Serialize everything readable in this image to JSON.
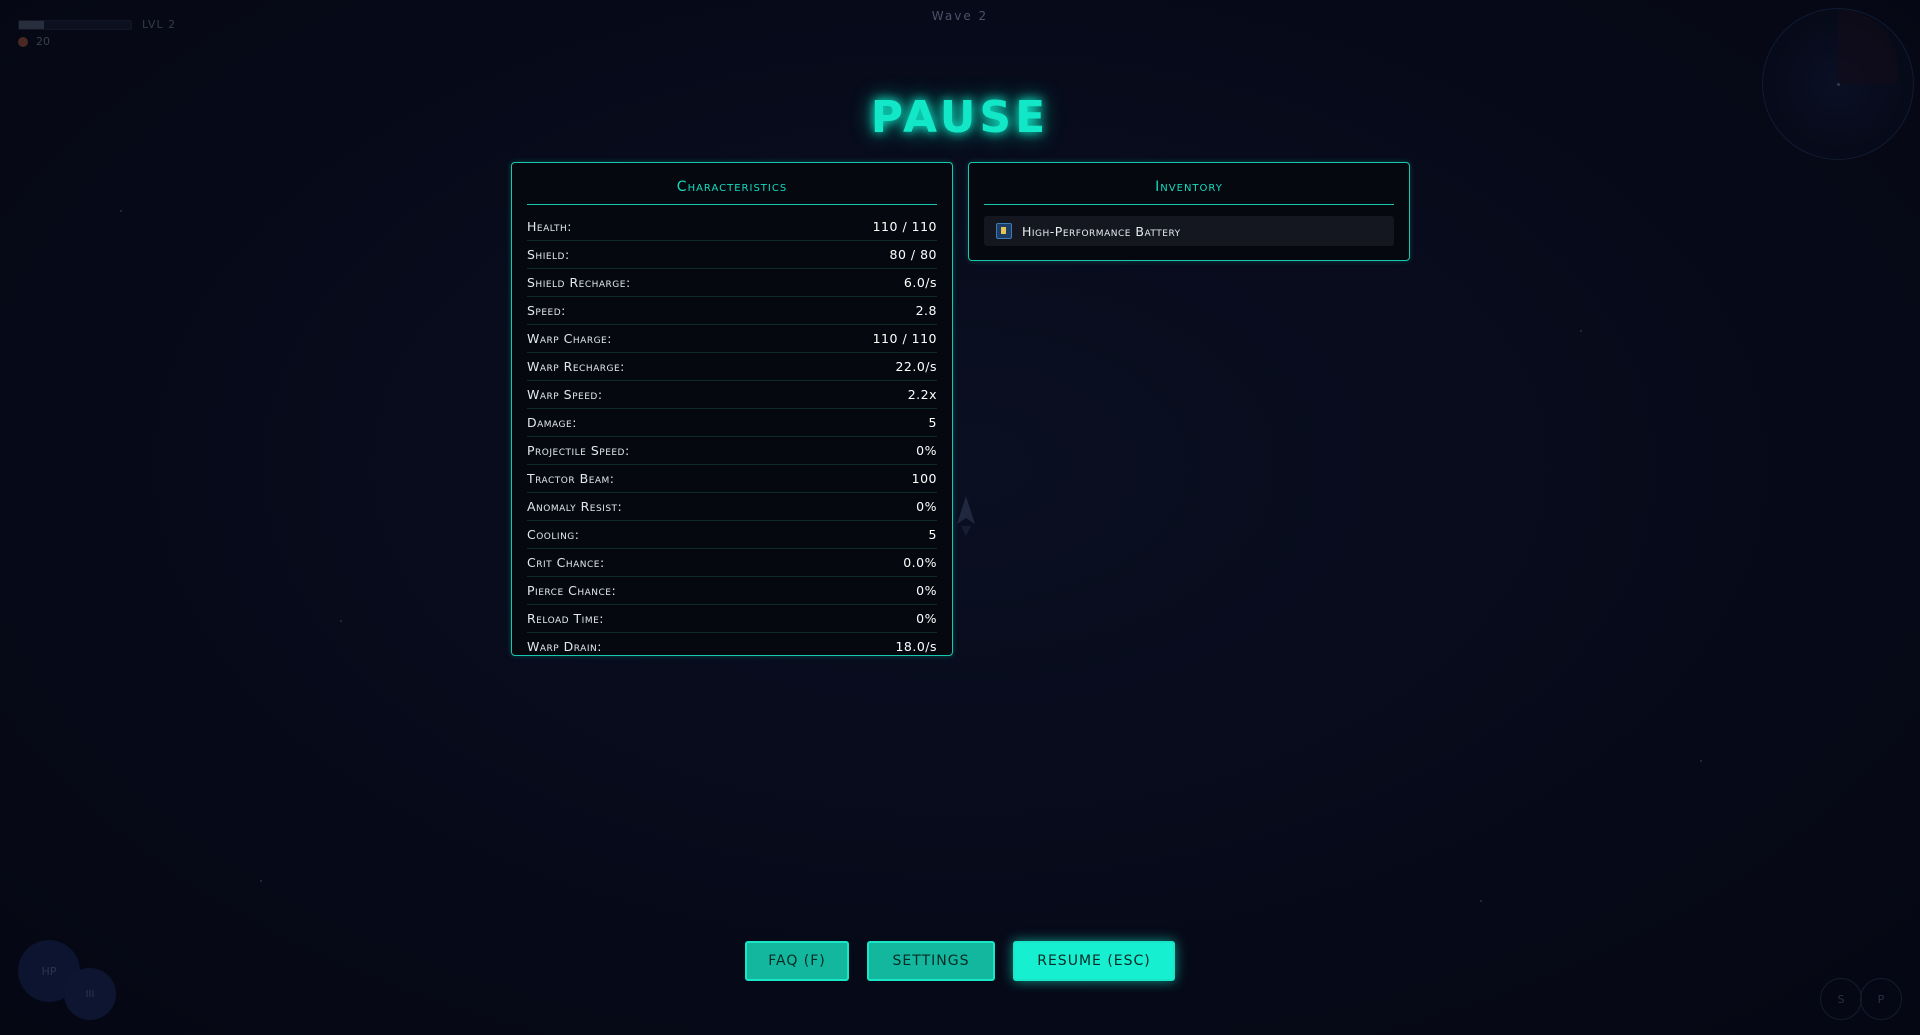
{
  "hud": {
    "level": "LVL 2",
    "xp_fraction": 0.22,
    "coins": "20",
    "wave": "Wave 2",
    "hp_label": "HP",
    "shield_label": "III",
    "btn_s": "S",
    "btn_p": "P"
  },
  "pause": {
    "title": "PAUSE",
    "characteristics": {
      "title": "Characteristics",
      "stats": [
        {
          "label": "Health:",
          "value": "110 / 110"
        },
        {
          "label": "Shield:",
          "value": "80 / 80"
        },
        {
          "label": "Shield Recharge:",
          "value": "6.0/s"
        },
        {
          "label": "Speed:",
          "value": "2.8"
        },
        {
          "label": "Warp Charge:",
          "value": "110 / 110"
        },
        {
          "label": "Warp Recharge:",
          "value": "22.0/s"
        },
        {
          "label": "Warp Speed:",
          "value": "2.2x"
        },
        {
          "label": "Damage:",
          "value": "5"
        },
        {
          "label": "Projectile Speed:",
          "value": "0%"
        },
        {
          "label": "Tractor Beam:",
          "value": "100"
        },
        {
          "label": "Anomaly Resist:",
          "value": "0%"
        },
        {
          "label": "Cooling:",
          "value": "5"
        },
        {
          "label": "Crit Chance:",
          "value": "0.0%"
        },
        {
          "label": "Pierce Chance:",
          "value": "0%"
        },
        {
          "label": "Reload Time:",
          "value": "0%"
        },
        {
          "label": "Warp Drain:",
          "value": "18.0/s"
        }
      ]
    },
    "inventory": {
      "title": "Inventory",
      "items": [
        {
          "name": "High-Performance Battery",
          "icon": "battery-icon"
        }
      ]
    },
    "buttons": {
      "faq": "FAQ (F)",
      "settings": "SETTINGS",
      "resume": "RESUME (ESC)"
    }
  },
  "colors": {
    "accent": "#14dcbf",
    "background": "#070a18"
  }
}
